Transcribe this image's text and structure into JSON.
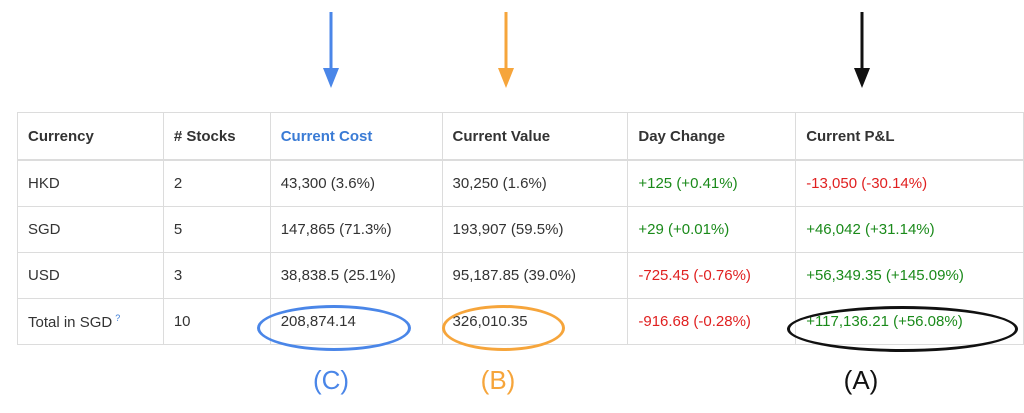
{
  "table": {
    "headers": [
      "Currency",
      "# Stocks",
      "Current Cost",
      "Current Value",
      "Day Change",
      "Current P&L"
    ],
    "rows": [
      {
        "currency": "HKD",
        "stocks": "2",
        "cost": "43,300 (3.6%)",
        "value": "30,250 (1.6%)",
        "day_change": "+125 (+0.41%)",
        "pnl": "-13,050 (-30.14%)"
      },
      {
        "currency": "SGD",
        "stocks": "5",
        "cost": "147,865 (71.3%)",
        "value": "193,907 (59.5%)",
        "day_change": "+29 (+0.01%)",
        "pnl": "+46,042 (+31.14%)"
      },
      {
        "currency": "USD",
        "stocks": "3",
        "cost": "38,838.5 (25.1%)",
        "value": "95,187.85 (39.0%)",
        "day_change": "-725.45 (-0.76%)",
        "pnl": "+56,349.35 (+145.09%)"
      },
      {
        "currency": "Total in SGD",
        "stocks": "10",
        "cost": "208,874.14",
        "value": "326,010.35",
        "day_change": "-916.68 (-0.28%)",
        "pnl": "+117,136.21 (+56.08%)"
      }
    ],
    "help_glyph": "?"
  },
  "annotations": {
    "label_c": "(C)",
    "label_b": "(B)",
    "label_a": "(A)",
    "color_c": "#4a86e8",
    "color_b": "#f6a53b",
    "color_a": "#111111"
  },
  "colors": {
    "positive": "#1a8a1a",
    "negative": "#e02020",
    "highlight_header": "#3a7bd5"
  },
  "icons": {
    "help": "help-icon",
    "arrow": "arrow-down-icon"
  }
}
